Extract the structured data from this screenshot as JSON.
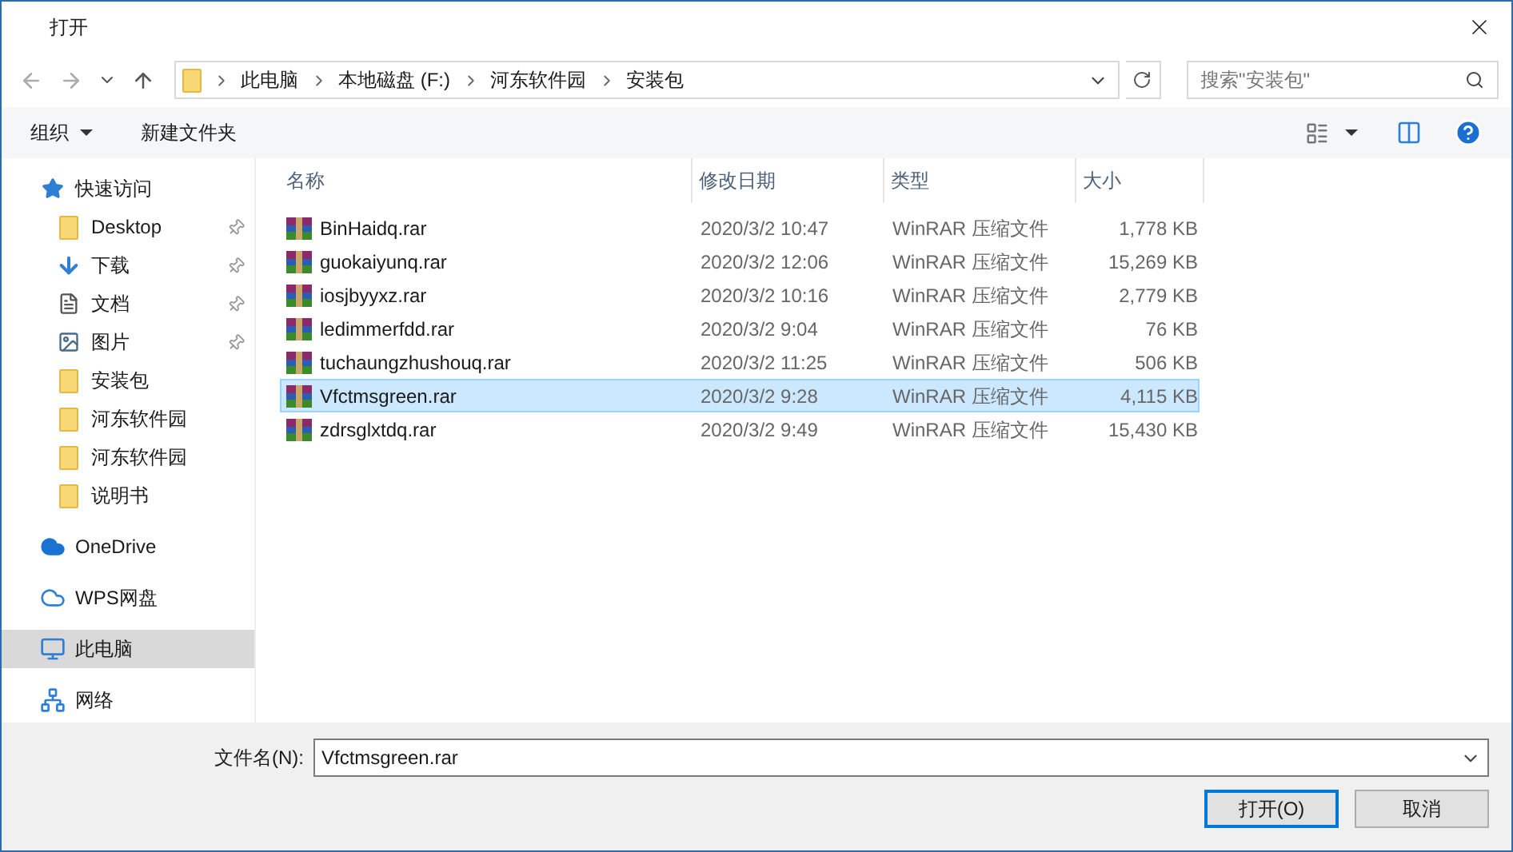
{
  "window": {
    "title": "打开"
  },
  "address": {
    "crumbs": [
      "此电脑",
      "本地磁盘 (F:)",
      "河东软件园",
      "安装包"
    ]
  },
  "search": {
    "placeholder": "搜索\"安装包\""
  },
  "toolbar": {
    "organize": "组织",
    "new_folder": "新建文件夹"
  },
  "sidebar": {
    "items": [
      {
        "kind": "star",
        "label": "快速访问",
        "pinned": false,
        "selected": false,
        "children": [
          {
            "kind": "folder",
            "label": "Desktop",
            "pinned": true,
            "selected": false
          },
          {
            "kind": "download",
            "label": "下载",
            "pinned": true,
            "selected": false
          },
          {
            "kind": "document",
            "label": "文档",
            "pinned": true,
            "selected": false
          },
          {
            "kind": "image",
            "label": "图片",
            "pinned": true,
            "selected": false
          },
          {
            "kind": "folder",
            "label": "安装包",
            "pinned": false,
            "selected": false
          },
          {
            "kind": "folder",
            "label": "河东软件园",
            "pinned": false,
            "selected": false
          },
          {
            "kind": "folder",
            "label": "河东软件园",
            "pinned": false,
            "selected": false
          },
          {
            "kind": "folder",
            "label": "说明书",
            "pinned": false,
            "selected": false
          }
        ]
      },
      {
        "kind": "cloud",
        "label": "OneDrive",
        "pinned": false,
        "selected": false
      },
      {
        "kind": "cloud-outline",
        "label": "WPS网盘",
        "pinned": false,
        "selected": false
      },
      {
        "kind": "computer",
        "label": "此电脑",
        "pinned": false,
        "selected": true
      },
      {
        "kind": "network",
        "label": "网络",
        "pinned": false,
        "selected": false
      }
    ]
  },
  "table": {
    "columns": [
      "名称",
      "修改日期",
      "类型",
      "大小"
    ],
    "rows": [
      {
        "name": "BinHaidq.rar",
        "date": "2020/3/2 10:47",
        "type": "WinRAR 压缩文件",
        "size": "1,778 KB",
        "selected": false
      },
      {
        "name": "guokaiyunq.rar",
        "date": "2020/3/2 12:06",
        "type": "WinRAR 压缩文件",
        "size": "15,269 KB",
        "selected": false
      },
      {
        "name": "iosjbyyxz.rar",
        "date": "2020/3/2 10:16",
        "type": "WinRAR 压缩文件",
        "size": "2,779 KB",
        "selected": false
      },
      {
        "name": "ledimmerfdd.rar",
        "date": "2020/3/2 9:04",
        "type": "WinRAR 压缩文件",
        "size": "76 KB",
        "selected": false
      },
      {
        "name": "tuchaungzhushouq.rar",
        "date": "2020/3/2 11:25",
        "type": "WinRAR 压缩文件",
        "size": "506 KB",
        "selected": false
      },
      {
        "name": "Vfctmsgreen.rar",
        "date": "2020/3/2 9:28",
        "type": "WinRAR 压缩文件",
        "size": "4,115 KB",
        "selected": true
      },
      {
        "name": "zdrsglxtdq.rar",
        "date": "2020/3/2 9:49",
        "type": "WinRAR 压缩文件",
        "size": "15,430 KB",
        "selected": false
      }
    ]
  },
  "footer": {
    "filename_label": "文件名(N):",
    "filename_value": "Vfctmsgreen.rar",
    "open_button": "打开(O)",
    "cancel_button": "取消"
  }
}
